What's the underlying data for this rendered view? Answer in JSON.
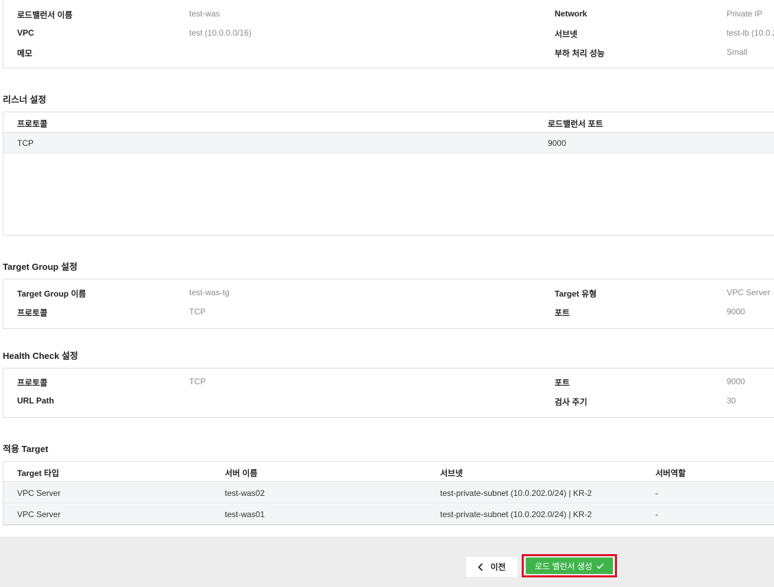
{
  "lb_info": {
    "name_label": "로드밸런서 이름",
    "name_value": "test-was",
    "network_label": "Network",
    "network_value": "Private IP",
    "vpc_label": "VPC",
    "vpc_value": "test (10.0.0.0/16)",
    "subnet_label": "서브넷",
    "subnet_value": "test-lb (10.0.2",
    "memo_label": "메모",
    "memo_value": "",
    "perf_label": "부하 처리 성능",
    "perf_value": "Small"
  },
  "listener": {
    "title": "리스너 설정",
    "headers": [
      "프로토콜",
      "로드밸런서 포트"
    ],
    "rows": [
      [
        "TCP",
        "9000"
      ]
    ]
  },
  "target_group": {
    "title": "Target Group 설정",
    "name_label": "Target Group 이름",
    "name_value": "test-was-tg",
    "type_label": "Target 유형",
    "type_value": "VPC Server",
    "protocol_label": "프로토콜",
    "protocol_value": "TCP",
    "port_label": "포트",
    "port_value": "9000"
  },
  "health_check": {
    "title": "Health Check 설정",
    "protocol_label": "프로토콜",
    "protocol_value": "TCP",
    "port_label": "포트",
    "port_value": "9000",
    "url_label": "URL Path",
    "url_value": "",
    "interval_label": "검사 주기",
    "interval_value": "30"
  },
  "applied_targets": {
    "title": "적용 Target",
    "headers": [
      "Target 타입",
      "서버 이름",
      "서브넷",
      "서버역할"
    ],
    "rows": [
      [
        "VPC Server",
        "test-was02",
        "test-private-subnet (10.0.202.0/24) | KR-2",
        "-"
      ],
      [
        "VPC Server",
        "test-was01",
        "test-private-subnet (10.0.202.0/24) | KR-2",
        "-"
      ]
    ]
  },
  "footer": {
    "prev_label": "이전",
    "create_label": "로드 밸런서 생성",
    "create_highlight_color": "#e0102a",
    "create_button_color": "#3fb44a"
  }
}
